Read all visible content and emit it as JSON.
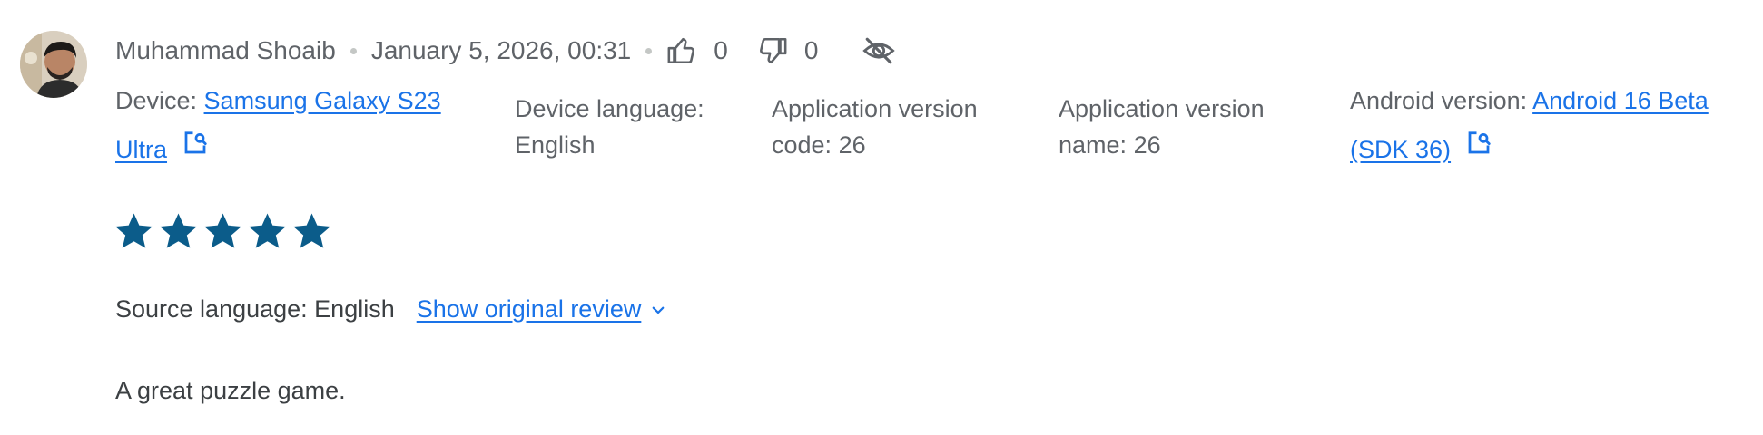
{
  "reviewer": {
    "name": "Muhammad Shoaib",
    "avatar_icon": "user-avatar"
  },
  "review_date": "January 5, 2026, 00:31",
  "votes": {
    "thumbs_up_count": "0",
    "thumbs_down_count": "0"
  },
  "device": {
    "label": "Device:",
    "value": "Samsung Galaxy S23 Ultra"
  },
  "device_language": {
    "label": "Device language:",
    "value": "English"
  },
  "app_version_code": {
    "label": "Application version code:",
    "value": "26"
  },
  "app_version_name": {
    "label": "Application version name:",
    "value": "26"
  },
  "android_version": {
    "label": "Android version:",
    "value": "Android 16 Beta (SDK 36)"
  },
  "rating": {
    "stars": 5,
    "max": 5
  },
  "source_language": "Source language: English",
  "show_original_label": "Show original review",
  "review_text": "A great puzzle game.",
  "colors": {
    "star": "#0b5c8a",
    "link": "#1a73e8",
    "muted": "#5f6368"
  }
}
